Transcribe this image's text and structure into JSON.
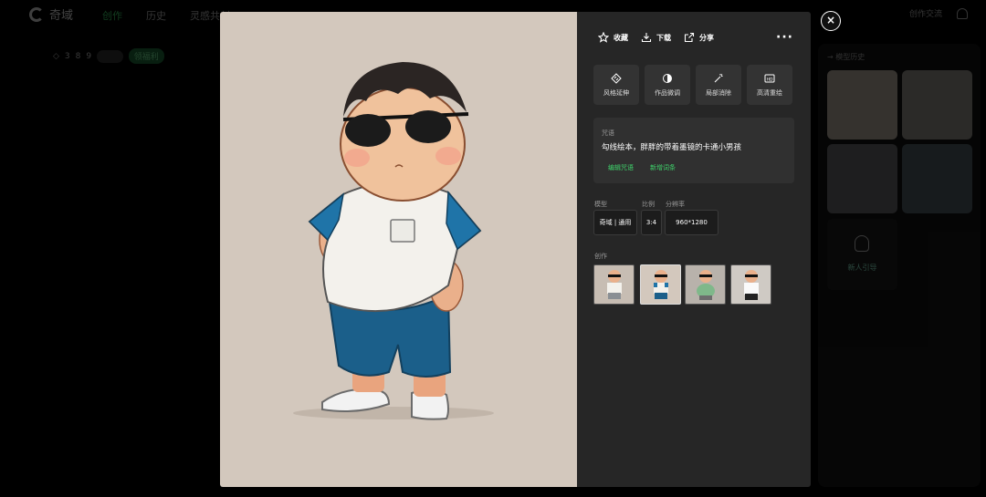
{
  "app": {
    "logo_text": "奇域",
    "nav": [
      "创作",
      "历史",
      "灵感共创"
    ],
    "top_right": {
      "community": "创作交流"
    },
    "points": {
      "digits": [
        "3",
        "8",
        "9"
      ],
      "badge": "领福利"
    }
  },
  "right_panel": {
    "title": "→ 模型历史",
    "add_label": "新人引导"
  },
  "modal": {
    "actions": {
      "favorite": "收藏",
      "download": "下载",
      "share": "分享",
      "more": "···"
    },
    "tools": [
      {
        "label": "风格延伸",
        "icon": "diamond-arrows-icon"
      },
      {
        "label": "作品微调",
        "icon": "half-circle-icon"
      },
      {
        "label": "局部消除",
        "icon": "magic-wand-icon"
      },
      {
        "label": "高清重绘",
        "icon": "hd-icon"
      }
    ],
    "prompt": {
      "label": "咒语",
      "text": "勾线绘本，胖胖的带着墨镜的卡通小男孩",
      "edit_label": "编辑咒语",
      "add_label": "新增词条"
    },
    "meta": {
      "model_label": "模型",
      "model_value": "奇域 | 通用",
      "ratio_label": "比例",
      "ratio_value": "3:4",
      "resolution_label": "分辨率",
      "resolution_value": "960*1280"
    },
    "works_label": "创作",
    "close": "×"
  },
  "colors": {
    "accent": "#3fd36b",
    "image_bg": "#d3c8bd",
    "shirt_blue": "#1f74a8",
    "shorts_blue": "#1b5f8a"
  }
}
